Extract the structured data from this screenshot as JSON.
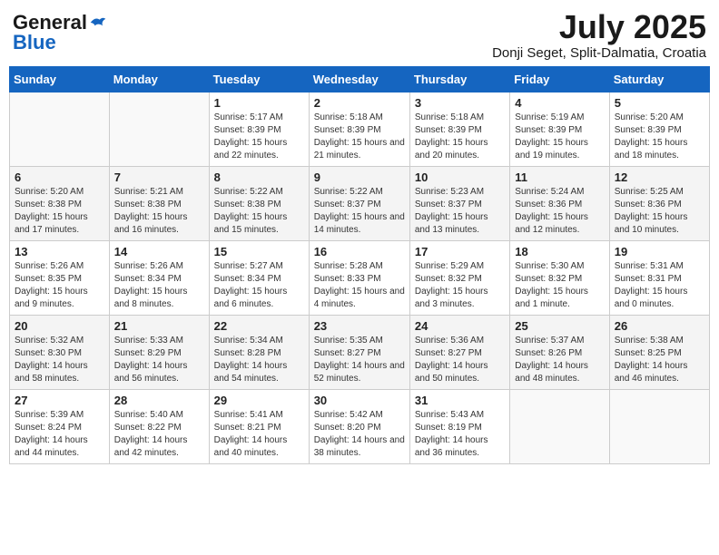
{
  "logo": {
    "general": "General",
    "blue": "Blue"
  },
  "title": {
    "month": "July 2025",
    "location": "Donji Seget, Split-Dalmatia, Croatia"
  },
  "weekdays": [
    "Sunday",
    "Monday",
    "Tuesday",
    "Wednesday",
    "Thursday",
    "Friday",
    "Saturday"
  ],
  "weeks": [
    [
      {
        "day": "",
        "sunrise": "",
        "sunset": "",
        "daylight": ""
      },
      {
        "day": "",
        "sunrise": "",
        "sunset": "",
        "daylight": ""
      },
      {
        "day": "1",
        "sunrise": "Sunrise: 5:17 AM",
        "sunset": "Sunset: 8:39 PM",
        "daylight": "Daylight: 15 hours and 22 minutes."
      },
      {
        "day": "2",
        "sunrise": "Sunrise: 5:18 AM",
        "sunset": "Sunset: 8:39 PM",
        "daylight": "Daylight: 15 hours and 21 minutes."
      },
      {
        "day": "3",
        "sunrise": "Sunrise: 5:18 AM",
        "sunset": "Sunset: 8:39 PM",
        "daylight": "Daylight: 15 hours and 20 minutes."
      },
      {
        "day": "4",
        "sunrise": "Sunrise: 5:19 AM",
        "sunset": "Sunset: 8:39 PM",
        "daylight": "Daylight: 15 hours and 19 minutes."
      },
      {
        "day": "5",
        "sunrise": "Sunrise: 5:20 AM",
        "sunset": "Sunset: 8:39 PM",
        "daylight": "Daylight: 15 hours and 18 minutes."
      }
    ],
    [
      {
        "day": "6",
        "sunrise": "Sunrise: 5:20 AM",
        "sunset": "Sunset: 8:38 PM",
        "daylight": "Daylight: 15 hours and 17 minutes."
      },
      {
        "day": "7",
        "sunrise": "Sunrise: 5:21 AM",
        "sunset": "Sunset: 8:38 PM",
        "daylight": "Daylight: 15 hours and 16 minutes."
      },
      {
        "day": "8",
        "sunrise": "Sunrise: 5:22 AM",
        "sunset": "Sunset: 8:38 PM",
        "daylight": "Daylight: 15 hours and 15 minutes."
      },
      {
        "day": "9",
        "sunrise": "Sunrise: 5:22 AM",
        "sunset": "Sunset: 8:37 PM",
        "daylight": "Daylight: 15 hours and 14 minutes."
      },
      {
        "day": "10",
        "sunrise": "Sunrise: 5:23 AM",
        "sunset": "Sunset: 8:37 PM",
        "daylight": "Daylight: 15 hours and 13 minutes."
      },
      {
        "day": "11",
        "sunrise": "Sunrise: 5:24 AM",
        "sunset": "Sunset: 8:36 PM",
        "daylight": "Daylight: 15 hours and 12 minutes."
      },
      {
        "day": "12",
        "sunrise": "Sunrise: 5:25 AM",
        "sunset": "Sunset: 8:36 PM",
        "daylight": "Daylight: 15 hours and 10 minutes."
      }
    ],
    [
      {
        "day": "13",
        "sunrise": "Sunrise: 5:26 AM",
        "sunset": "Sunset: 8:35 PM",
        "daylight": "Daylight: 15 hours and 9 minutes."
      },
      {
        "day": "14",
        "sunrise": "Sunrise: 5:26 AM",
        "sunset": "Sunset: 8:34 PM",
        "daylight": "Daylight: 15 hours and 8 minutes."
      },
      {
        "day": "15",
        "sunrise": "Sunrise: 5:27 AM",
        "sunset": "Sunset: 8:34 PM",
        "daylight": "Daylight: 15 hours and 6 minutes."
      },
      {
        "day": "16",
        "sunrise": "Sunrise: 5:28 AM",
        "sunset": "Sunset: 8:33 PM",
        "daylight": "Daylight: 15 hours and 4 minutes."
      },
      {
        "day": "17",
        "sunrise": "Sunrise: 5:29 AM",
        "sunset": "Sunset: 8:32 PM",
        "daylight": "Daylight: 15 hours and 3 minutes."
      },
      {
        "day": "18",
        "sunrise": "Sunrise: 5:30 AM",
        "sunset": "Sunset: 8:32 PM",
        "daylight": "Daylight: 15 hours and 1 minute."
      },
      {
        "day": "19",
        "sunrise": "Sunrise: 5:31 AM",
        "sunset": "Sunset: 8:31 PM",
        "daylight": "Daylight: 15 hours and 0 minutes."
      }
    ],
    [
      {
        "day": "20",
        "sunrise": "Sunrise: 5:32 AM",
        "sunset": "Sunset: 8:30 PM",
        "daylight": "Daylight: 14 hours and 58 minutes."
      },
      {
        "day": "21",
        "sunrise": "Sunrise: 5:33 AM",
        "sunset": "Sunset: 8:29 PM",
        "daylight": "Daylight: 14 hours and 56 minutes."
      },
      {
        "day": "22",
        "sunrise": "Sunrise: 5:34 AM",
        "sunset": "Sunset: 8:28 PM",
        "daylight": "Daylight: 14 hours and 54 minutes."
      },
      {
        "day": "23",
        "sunrise": "Sunrise: 5:35 AM",
        "sunset": "Sunset: 8:27 PM",
        "daylight": "Daylight: 14 hours and 52 minutes."
      },
      {
        "day": "24",
        "sunrise": "Sunrise: 5:36 AM",
        "sunset": "Sunset: 8:27 PM",
        "daylight": "Daylight: 14 hours and 50 minutes."
      },
      {
        "day": "25",
        "sunrise": "Sunrise: 5:37 AM",
        "sunset": "Sunset: 8:26 PM",
        "daylight": "Daylight: 14 hours and 48 minutes."
      },
      {
        "day": "26",
        "sunrise": "Sunrise: 5:38 AM",
        "sunset": "Sunset: 8:25 PM",
        "daylight": "Daylight: 14 hours and 46 minutes."
      }
    ],
    [
      {
        "day": "27",
        "sunrise": "Sunrise: 5:39 AM",
        "sunset": "Sunset: 8:24 PM",
        "daylight": "Daylight: 14 hours and 44 minutes."
      },
      {
        "day": "28",
        "sunrise": "Sunrise: 5:40 AM",
        "sunset": "Sunset: 8:22 PM",
        "daylight": "Daylight: 14 hours and 42 minutes."
      },
      {
        "day": "29",
        "sunrise": "Sunrise: 5:41 AM",
        "sunset": "Sunset: 8:21 PM",
        "daylight": "Daylight: 14 hours and 40 minutes."
      },
      {
        "day": "30",
        "sunrise": "Sunrise: 5:42 AM",
        "sunset": "Sunset: 8:20 PM",
        "daylight": "Daylight: 14 hours and 38 minutes."
      },
      {
        "day": "31",
        "sunrise": "Sunrise: 5:43 AM",
        "sunset": "Sunset: 8:19 PM",
        "daylight": "Daylight: 14 hours and 36 minutes."
      },
      {
        "day": "",
        "sunrise": "",
        "sunset": "",
        "daylight": ""
      },
      {
        "day": "",
        "sunrise": "",
        "sunset": "",
        "daylight": ""
      }
    ]
  ]
}
